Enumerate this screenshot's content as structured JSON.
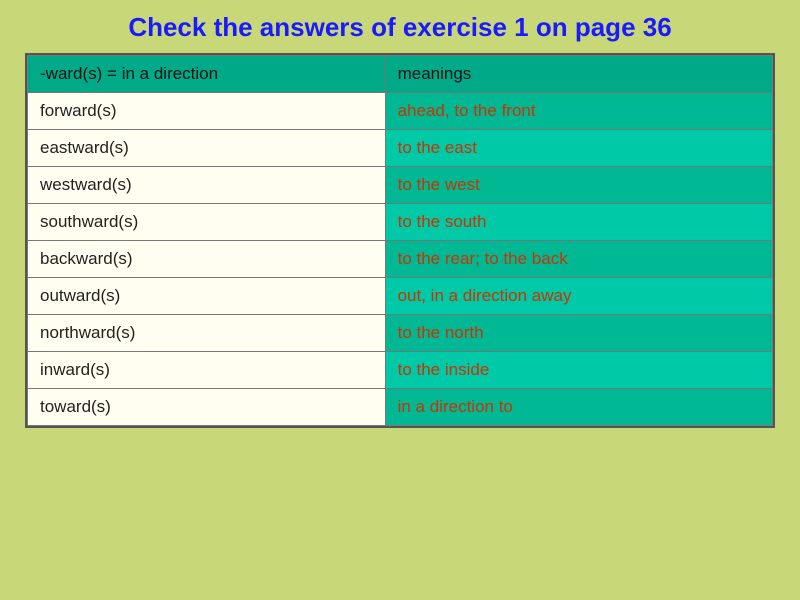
{
  "title": "Check the answers of exercise 1 on page 36",
  "table": {
    "header": {
      "col1": "-ward(s) = in a direction",
      "col2": "meanings"
    },
    "rows": [
      {
        "term": "forward(s)",
        "meaning": "ahead, to the front"
      },
      {
        "term": "eastward(s)",
        "meaning": "to the east"
      },
      {
        "term": "westward(s)",
        "meaning": "to the west"
      },
      {
        "term": "southward(s)",
        "meaning": "to the south"
      },
      {
        "term": "backward(s)",
        "meaning": "to the rear; to the back"
      },
      {
        "term": "outward(s)",
        "meaning": "out, in a direction away"
      },
      {
        "term": "northward(s)",
        "meaning": "to the north"
      },
      {
        "term": "inward(s)",
        "meaning": "to the inside"
      },
      {
        "term": "toward(s)",
        "meaning": "in a direction to"
      }
    ]
  }
}
